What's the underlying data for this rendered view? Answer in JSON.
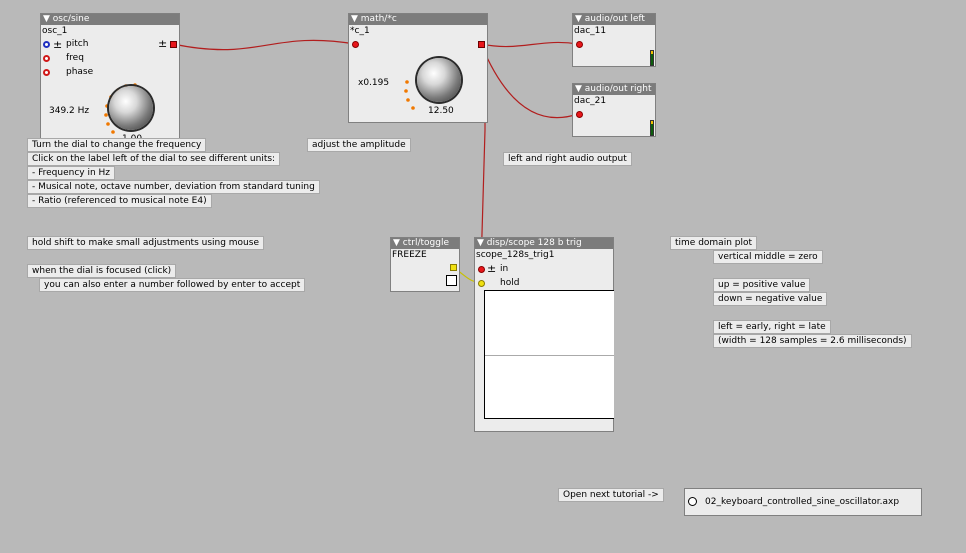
{
  "osc": {
    "title": "▼ osc/sine",
    "instance": "osc_1",
    "pm": "±",
    "pm_out": "±",
    "pitch_label": "pitch",
    "freq_label": "freq",
    "phase_label": "phase",
    "dial_value": "349.2 Hz",
    "dial_secondary": "1.00"
  },
  "math": {
    "title": "▼ math/*c",
    "instance": "*c_1",
    "value": "x0.195",
    "dial_value": "12.50"
  },
  "out_left": {
    "title": "▼ audio/out left",
    "instance": "dac_11"
  },
  "out_right": {
    "title": "▼ audio/out right",
    "instance": "dac_21"
  },
  "toggle": {
    "title": "▼ ctrl/toggle",
    "label": "FREEZE"
  },
  "scope": {
    "title": "▼ disp/scope 128 b trig",
    "instance": "scope_128s_trig1",
    "pm": "±",
    "in_label": "in",
    "hold_label": "hold"
  },
  "notes": {
    "n1": "Turn the dial to change the frequency",
    "n2": "Click on the label left of the dial to see different units:",
    "n3": "- Frequency in Hz",
    "n4": "- Musical note, octave number, deviation from standard tuning",
    "n5": "- Ratio (referenced to musical note E4)",
    "n6": "hold shift to make small adjustments using mouse",
    "n7": "when the dial is focused (click)",
    "n8": "you can also enter a number followed by enter to accept",
    "n9": "adjust the amplitude",
    "n10": "left and right audio output",
    "n11": "time domain plot",
    "n12": "vertical middle = zero",
    "n13": "up = positive value",
    "n14": "down = negative value",
    "n15": "left = early, right = late",
    "n16": "(width = 128 samples = 2.6 milliseconds)",
    "n17": "Open next tutorial ->"
  },
  "next_patch": {
    "name": "02_keyboard_controlled_sine_oscillator.axp"
  },
  "colors": {
    "wire": "#b21e1e",
    "wire_yellow": "#c8c000",
    "canvas": "#b9b9b9",
    "header": "#7c7c7c",
    "dial_dots": "#f07800"
  }
}
